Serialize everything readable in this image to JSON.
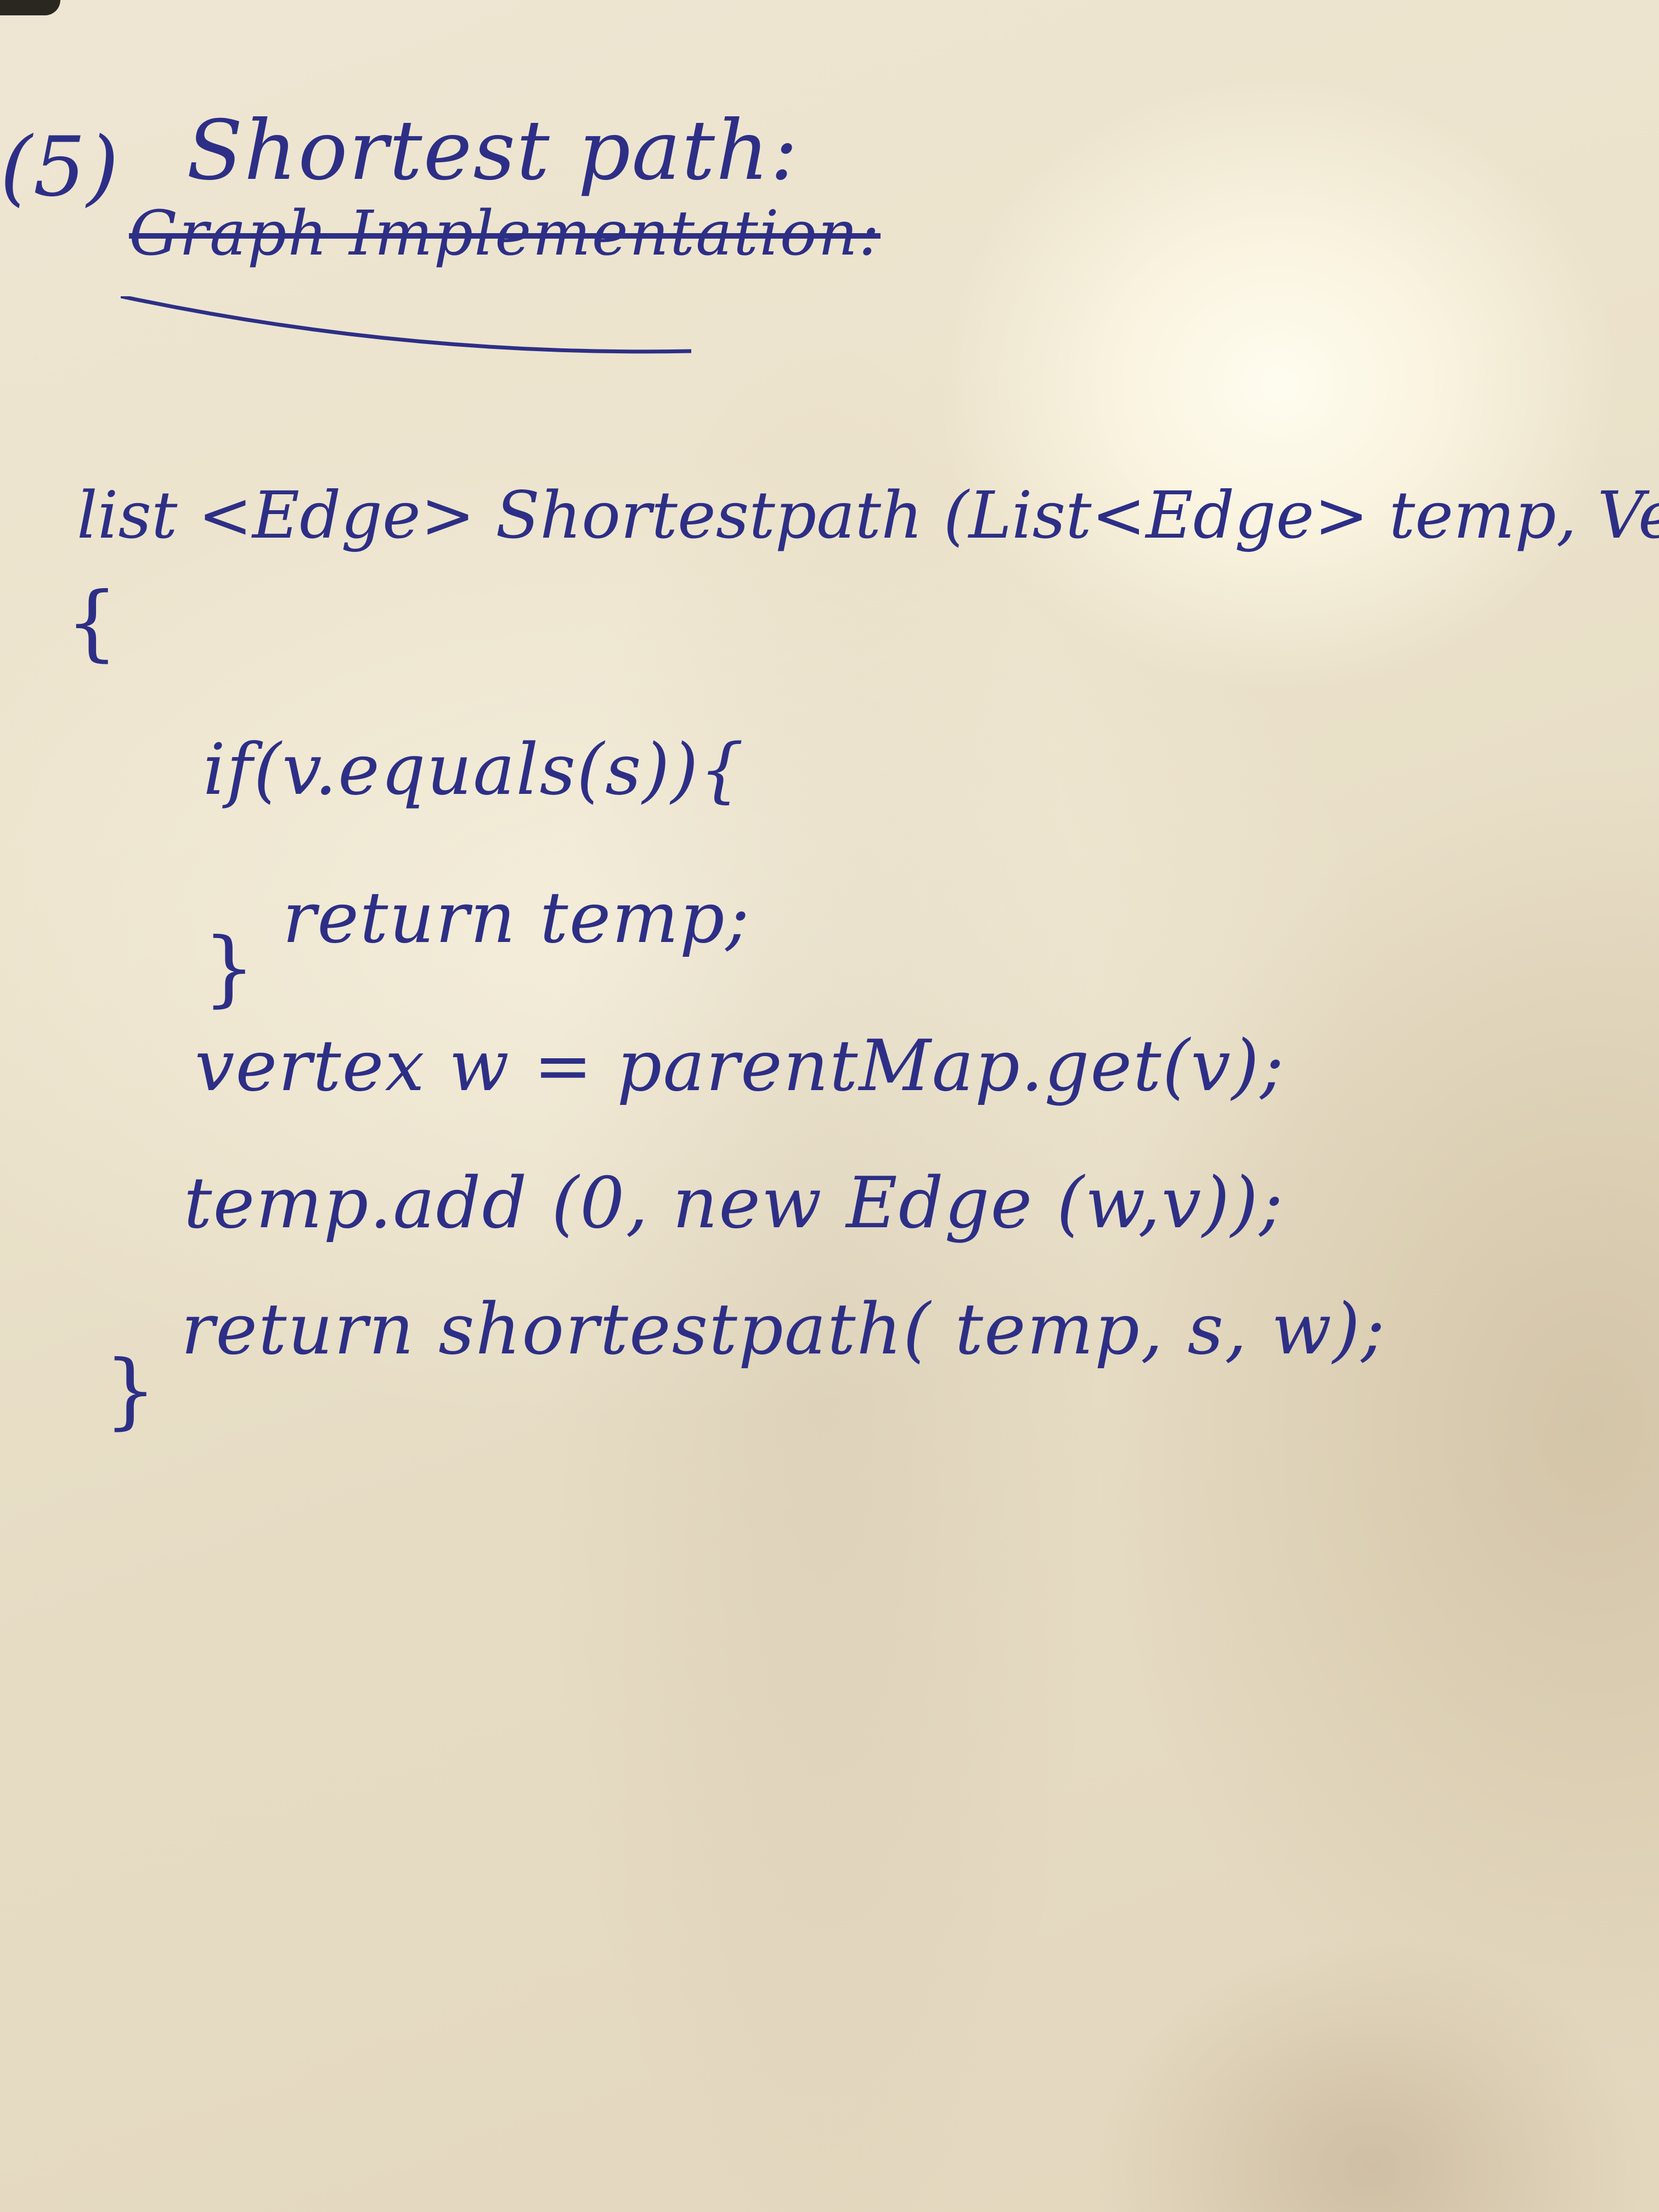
{
  "heading": {
    "number": "(5)",
    "title": "Shortest path:",
    "struck_subtitle": "Graph Implementation:"
  },
  "code": {
    "signature": "list <Edge> Shortestpath (List<Edge> temp, Vertex s,vertex",
    "open_brace": "{",
    "if_line": "if(v.equals(s)){",
    "return_temp": "return temp;",
    "close_if": "}",
    "vertex_line": "vertex w = parentMap.get(v);",
    "add_line": "temp.add (0, new Edge (w,v));",
    "return_recursive": "return shortestpath( temp, s, w);",
    "close_brace": "}"
  },
  "colors": {
    "ink": "#2d2f86",
    "paper": "#ece3cc"
  }
}
